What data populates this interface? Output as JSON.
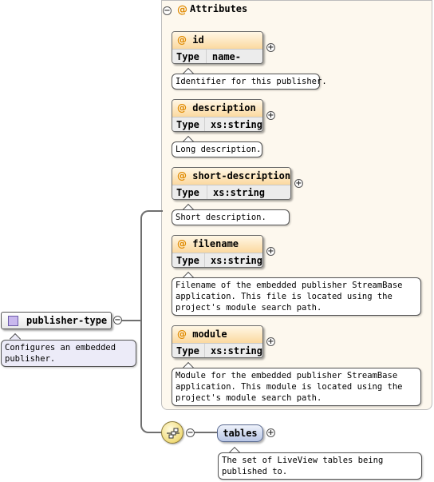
{
  "attributes_group": {
    "title": "Attributes",
    "at_symbol": "@",
    "toggle": "−"
  },
  "attributes": [
    {
      "name": "id",
      "type_key": "Type",
      "type_value": "name-type",
      "note": "Identifier for this publisher."
    },
    {
      "name": "description",
      "type_key": "Type",
      "type_value": "xs:string",
      "note": "Long description."
    },
    {
      "name": "short-description",
      "type_key": "Type",
      "type_value": "xs:string",
      "note": "Short description."
    },
    {
      "name": "filename",
      "type_key": "Type",
      "type_value": "xs:string",
      "note": "Filename of the embedded publisher StreamBase\napplication. This file is located using the\nproject's module search path."
    },
    {
      "name": "module",
      "type_key": "Type",
      "type_value": "xs:string",
      "note": "Module for the embedded publisher StreamBase\napplication. This module is located using the\nproject's module search path."
    }
  ],
  "expand_symbol": "+",
  "collapse_symbol": "−",
  "root": {
    "name": "publisher-type",
    "note": "Configures an embedded\npublisher."
  },
  "sequence": {
    "icon": "sequence-icon"
  },
  "child": {
    "name": "tables",
    "note": "The set of LiveView tables being\npublished to."
  },
  "colors": {
    "attr_header": "#fbd9a0",
    "panel": "#fdf8ee",
    "root_icon": "#c9b8ee",
    "child": "#b8c6e6"
  }
}
